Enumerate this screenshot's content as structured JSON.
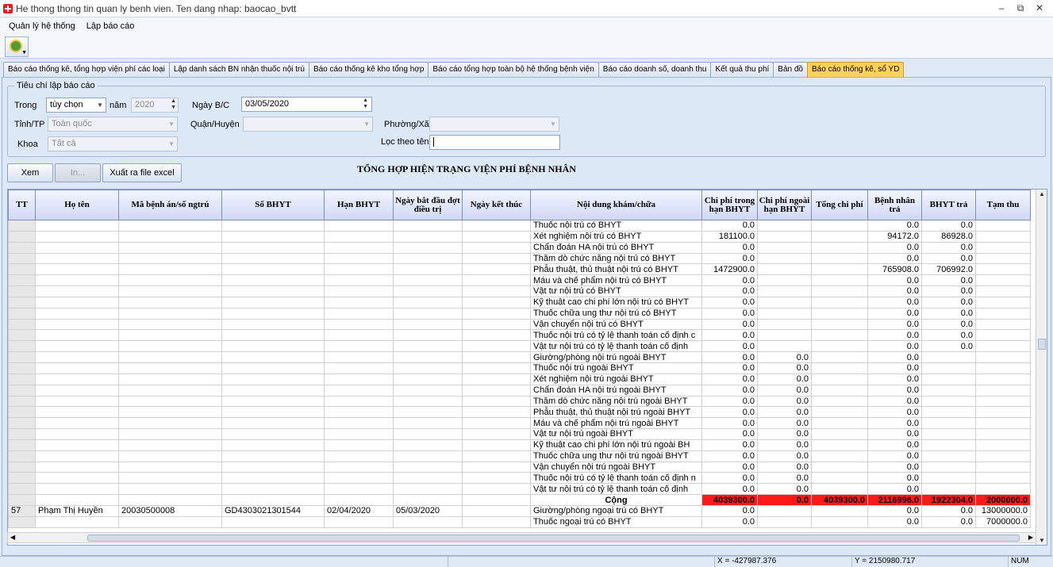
{
  "window": {
    "title": "He thong thong tin quan ly benh vien. Ten dang nhap: baocao_bvtt",
    "controls": [
      "–",
      "⧉",
      "✕"
    ]
  },
  "menu": [
    "Quản lý hệ thống",
    "Lập báo cáo"
  ],
  "tabs": [
    "Báo cáo thống kê, tổng hợp viện phí các loại",
    "Lập danh sách BN nhận thuốc nội trú",
    "Báo cáo thống kê kho tổng hợp",
    "Báo cáo tổng hợp toàn bộ hệ thống bệnh viện",
    "Báo cáo doanh số, doanh thu",
    "Kết quả thu phí",
    "Bản đồ",
    "Báo cáo thống kê, sổ YD"
  ],
  "active_tab": 7,
  "criteria": {
    "legend": "Tiêu chí lập báo cáo",
    "trong_label": "Trong",
    "trong_value": "tùy chọn",
    "nam_label": "năm",
    "nam_value": "2020",
    "ngay_label": "Ngày B/C",
    "ngay_value": "03/05/2020",
    "tinh_label": "Tỉnh/TP",
    "tinh_value": "Toàn quốc",
    "quan_label": "Quận/Huyện",
    "quan_value": "",
    "phuong_label": "Phường/Xã",
    "phuong_value": "",
    "khoa_label": "Khoa",
    "khoa_value": "Tất cả",
    "loc_label": "Lọc theo tên",
    "loc_value": ""
  },
  "buttons": {
    "xem": "Xem",
    "in": "In...",
    "excel": "Xuất ra file excel"
  },
  "report_title": "TỔNG HỢP HIỆN TRẠNG VIỆN PHÍ BỆNH NHÂN",
  "columns": [
    "TT",
    "Họ tên",
    "Mã bệnh án/số ngtrú",
    "Số BHYT",
    "Hạn BHYT",
    "Ngày bắt đầu đợt điều trị",
    "Ngày kết thúc",
    "Nội dung khám/chữa",
    "Chi phí trong hạn BHYT",
    "Chi phí ngoài hạn BHYT",
    "Tổng chi phí",
    "Bệnh nhân trả",
    "BHYT trả",
    "Tạm thu"
  ],
  "rows": [
    [
      "",
      "",
      "",
      "",
      "",
      "",
      "",
      "Thuốc nội trú có BHYT",
      "0.0",
      "",
      "",
      "0.0",
      "0.0",
      ""
    ],
    [
      "",
      "",
      "",
      "",
      "",
      "",
      "",
      "Xét nghiệm nội trú có BHYT",
      "181100.0",
      "",
      "",
      "94172.0",
      "86928.0",
      ""
    ],
    [
      "",
      "",
      "",
      "",
      "",
      "",
      "",
      "Chẩn đoán HA nội trú có BHYT",
      "0.0",
      "",
      "",
      "0.0",
      "0.0",
      ""
    ],
    [
      "",
      "",
      "",
      "",
      "",
      "",
      "",
      "Thăm dò chức năng nội trú có BHYT",
      "0.0",
      "",
      "",
      "0.0",
      "0.0",
      ""
    ],
    [
      "",
      "",
      "",
      "",
      "",
      "",
      "",
      "Phẫu thuật, thủ thuật nội trú có BHYT",
      "1472900.0",
      "",
      "",
      "765908.0",
      "706992.0",
      ""
    ],
    [
      "",
      "",
      "",
      "",
      "",
      "",
      "",
      "Máu và chế phẩm nội trú có BHYT",
      "0.0",
      "",
      "",
      "0.0",
      "0.0",
      ""
    ],
    [
      "",
      "",
      "",
      "",
      "",
      "",
      "",
      "Vật tư nội trú có BHYT",
      "0.0",
      "",
      "",
      "0.0",
      "0.0",
      ""
    ],
    [
      "",
      "",
      "",
      "",
      "",
      "",
      "",
      "Kỹ thuật cao chi phí lớn nội trú có BHYT",
      "0.0",
      "",
      "",
      "0.0",
      "0.0",
      ""
    ],
    [
      "",
      "",
      "",
      "",
      "",
      "",
      "",
      "Thuốc chữa ung thư nội trú có BHYT",
      "0.0",
      "",
      "",
      "0.0",
      "0.0",
      ""
    ],
    [
      "",
      "",
      "",
      "",
      "",
      "",
      "",
      "Vận chuyển nội trú có BHYT",
      "0.0",
      "",
      "",
      "0.0",
      "0.0",
      ""
    ],
    [
      "",
      "",
      "",
      "",
      "",
      "",
      "",
      "Thuốc nội trú có tỷ lệ thanh toán cố định c",
      "0.0",
      "",
      "",
      "0.0",
      "0.0",
      ""
    ],
    [
      "",
      "",
      "",
      "",
      "",
      "",
      "",
      "Vật tư nội trú có tỷ lệ thanh toán cố định",
      "0.0",
      "",
      "",
      "0.0",
      "0.0",
      ""
    ],
    [
      "",
      "",
      "",
      "",
      "",
      "",
      "",
      "Giường/phòng nội trú ngoài BHYT",
      "0.0",
      "0.0",
      "",
      "0.0",
      "",
      ""
    ],
    [
      "",
      "",
      "",
      "",
      "",
      "",
      "",
      "Thuốc nội trú ngoài BHYT",
      "0.0",
      "0.0",
      "",
      "0.0",
      "",
      ""
    ],
    [
      "",
      "",
      "",
      "",
      "",
      "",
      "",
      "Xét nghiệm nội trú ngoài BHYT",
      "0.0",
      "0.0",
      "",
      "0.0",
      "",
      ""
    ],
    [
      "",
      "",
      "",
      "",
      "",
      "",
      "",
      "Chẩn đoán HA nội trú ngoài BHYT",
      "0.0",
      "0.0",
      "",
      "0.0",
      "",
      ""
    ],
    [
      "",
      "",
      "",
      "",
      "",
      "",
      "",
      "Thăm dò chức năng nội trú ngoài BHYT",
      "0.0",
      "0.0",
      "",
      "0.0",
      "",
      ""
    ],
    [
      "",
      "",
      "",
      "",
      "",
      "",
      "",
      "Phẫu thuật, thủ thuật nội trú ngoài BHYT",
      "0.0",
      "0.0",
      "",
      "0.0",
      "",
      ""
    ],
    [
      "",
      "",
      "",
      "",
      "",
      "",
      "",
      "Máu và chế phẩm nội trú ngoài BHYT",
      "0.0",
      "0.0",
      "",
      "0.0",
      "",
      ""
    ],
    [
      "",
      "",
      "",
      "",
      "",
      "",
      "",
      "Vật tư nội trú ngoài BHYT",
      "0.0",
      "0.0",
      "",
      "0.0",
      "",
      ""
    ],
    [
      "",
      "",
      "",
      "",
      "",
      "",
      "",
      "Kỹ thuật cao chi phí lớn nội trú ngoài BH",
      "0.0",
      "0.0",
      "",
      "0.0",
      "",
      ""
    ],
    [
      "",
      "",
      "",
      "",
      "",
      "",
      "",
      "Thuốc chữa ung thư nội trú ngoài BHYT",
      "0.0",
      "0.0",
      "",
      "0.0",
      "",
      ""
    ],
    [
      "",
      "",
      "",
      "",
      "",
      "",
      "",
      "Vận chuyển nội trú ngoài BHYT",
      "0.0",
      "0.0",
      "",
      "0.0",
      "",
      ""
    ],
    [
      "",
      "",
      "",
      "",
      "",
      "",
      "",
      "Thuốc nội trú có tỷ lệ thanh toán cố định n",
      "0.0",
      "0.0",
      "",
      "0.0",
      "",
      ""
    ],
    [
      "",
      "",
      "",
      "",
      "",
      "",
      "",
      "Vật tư nội trú  có tỷ lệ thanh toán cố định",
      "0.0",
      "0.0",
      "",
      "0.0",
      "",
      ""
    ]
  ],
  "total_row": [
    "",
    "",
    "",
    "",
    "",
    "",
    "",
    "Cộng",
    "4039300.0",
    "0.0",
    "4039300.0",
    "2116996.0",
    "1922304.0",
    "2000000.0"
  ],
  "patient_rows": [
    [
      "57",
      "Phạm Thị Huyền",
      "20030500008",
      "GD4303021301544",
      "02/04/2020",
      "05/03/2020",
      "",
      "Giường/phòng ngoại trú có BHYT",
      "0.0",
      "",
      "",
      "0.0",
      "0.0",
      "13000000.0"
    ],
    [
      "",
      "",
      "",
      "",
      "",
      "",
      "",
      "Thuốc ngoại trú có BHYT",
      "0.0",
      "",
      "",
      "0.0",
      "0.0",
      "7000000.0"
    ]
  ],
  "status": {
    "x": "X = -427987.376",
    "y": "Y = 2150980.717",
    "num": "NUM"
  }
}
